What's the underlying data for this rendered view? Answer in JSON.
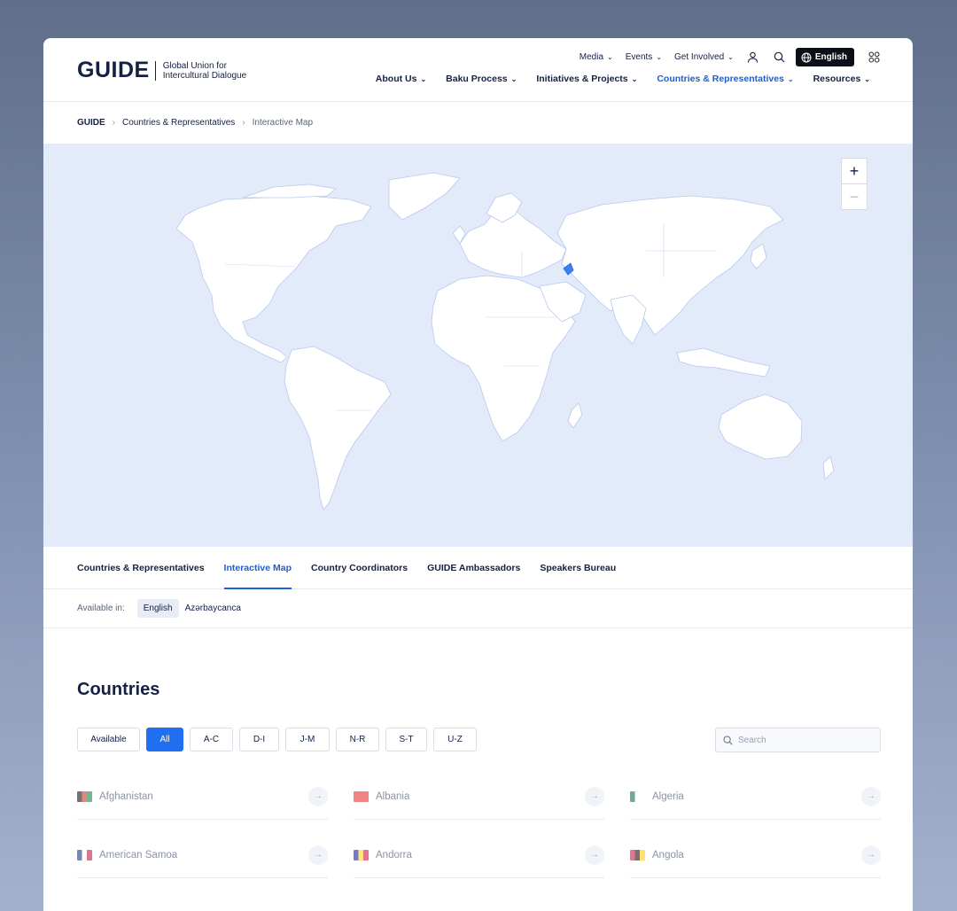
{
  "header": {
    "logo_word": "GUIDE",
    "logo_tagline_1": "Global Union for",
    "logo_tagline_2": "Intercultural Dialogue",
    "top_links": [
      "Media",
      "Events",
      "Get Involved"
    ],
    "language_button": "English",
    "nav": [
      "About Us",
      "Baku Process",
      "Initiatives & Projects",
      "Countries & Representatives",
      "Resources"
    ],
    "active_nav": "Countries & Representatives"
  },
  "breadcrumb": [
    "GUIDE",
    "Countries & Representatives",
    "Interactive Map"
  ],
  "map": {
    "zoom_in": "+",
    "zoom_out": "−",
    "colors": {
      "water": "#e3ebfb",
      "land": "#ffffff",
      "border": "#b9c9ea",
      "highlight": "#3b82f6"
    }
  },
  "tabs": [
    "Countries & Representatives",
    "Interactive Map",
    "Country Coordinators",
    "GUIDE Ambassadors",
    "Speakers Bureau"
  ],
  "active_tab": "Interactive Map",
  "availability": {
    "label": "Available in:",
    "options": [
      "English",
      "Azərbaycanca"
    ],
    "selected": "English"
  },
  "countries": {
    "title": "Countries",
    "filters": [
      "Available",
      "All",
      "A-C",
      "D-I",
      "J-M",
      "N-R",
      "S-T",
      "U-Z"
    ],
    "active_filter": "All",
    "search_placeholder": "Search",
    "items": [
      {
        "name": "Afghanistan",
        "flag_colors": [
          "#000000",
          "#d32011",
          "#007a36"
        ]
      },
      {
        "name": "Albania",
        "flag_colors": [
          "#e41e20",
          "#e41e20",
          "#e41e20"
        ]
      },
      {
        "name": "Algeria",
        "flag_colors": [
          "#006233",
          "#ffffff",
          "#ffffff"
        ]
      },
      {
        "name": "American Samoa",
        "flag_colors": [
          "#002b7f",
          "#ffffff",
          "#bf0a30"
        ]
      },
      {
        "name": "Andorra",
        "flag_colors": [
          "#10069f",
          "#fedd00",
          "#d50032"
        ]
      },
      {
        "name": "Angola",
        "flag_colors": [
          "#cc092f",
          "#000000",
          "#ffcb00"
        ]
      }
    ]
  }
}
